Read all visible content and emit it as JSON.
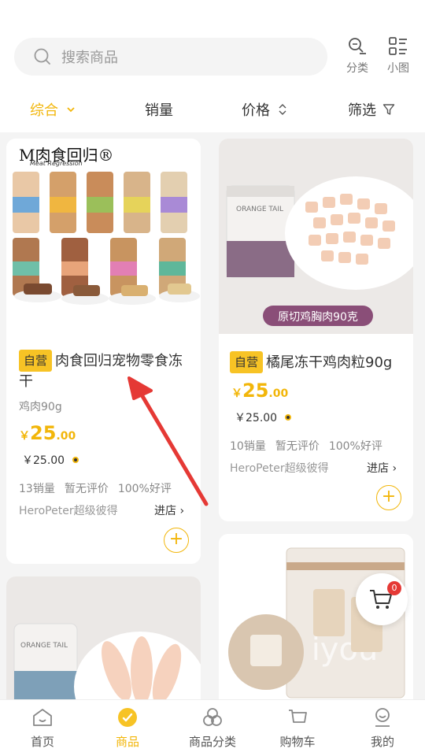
{
  "header": {
    "search_placeholder": "搜索商品",
    "category_label": "分类",
    "smallview_label": "小图"
  },
  "sortbar": {
    "items": [
      {
        "label": "综合"
      },
      {
        "label": "销量"
      },
      {
        "label": "价格"
      },
      {
        "label": "筛选"
      }
    ]
  },
  "products": [
    {
      "tag": "自营",
      "title": "肉食回归宠物零食冻干",
      "spec": "鸡肉90g",
      "price_currency": "￥",
      "price_int": "25",
      "price_dec": ".00",
      "price2": "￥25.00",
      "sales": "13销量",
      "reviews": "暂无评价",
      "rating": "100%好评",
      "store": "HeroPeter超级彼得",
      "enter_store": "进店",
      "image_brand": "M肉食回归®",
      "image_sub": "Meat Regression"
    },
    {
      "tag": "自营",
      "title": "橘尾冻干鸡肉粒90g",
      "price_currency": "￥",
      "price_int": "25",
      "price_dec": ".00",
      "price2": "￥25.00",
      "sales": "10销量",
      "reviews": "暂无评价",
      "rating": "100%好评",
      "store": "HeroPeter超级彼得",
      "enter_store": "进店",
      "image_caption": "原切鸡胸肉90克",
      "image_brand": "ORANGE TAIL"
    },
    {
      "image_brand": "ORANGE TAIL"
    },
    {
      "image_text": "iyou"
    }
  ],
  "cart_badge": "0",
  "nav": {
    "items": [
      {
        "label": "首页"
      },
      {
        "label": "商品"
      },
      {
        "label": "商品分类"
      },
      {
        "label": "购物车"
      },
      {
        "label": "我的"
      }
    ]
  },
  "colors": {
    "accent": "#f2b60a",
    "tag": "#f7c325",
    "arrow": "#e53935"
  }
}
